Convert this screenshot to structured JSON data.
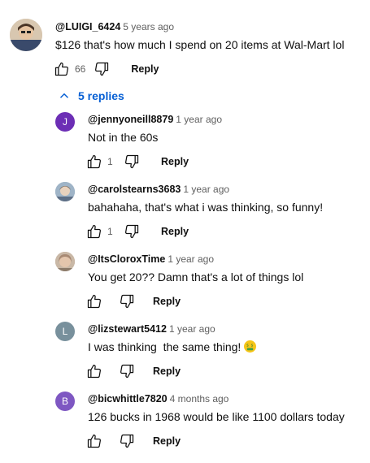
{
  "top_comment": {
    "author": "@LUIGI_6424",
    "time": "5 years ago",
    "text": "$126 that's how much I spend on 20 items at Wal-Mart lol",
    "likes": "66",
    "reply_label": "Reply"
  },
  "replies_toggle": {
    "label": "5 replies"
  },
  "replies": [
    {
      "author": "@jennyoneill8879",
      "time": "1 year ago",
      "text": "Not in the 60s",
      "likes": "1",
      "reply_label": "Reply",
      "avatar_letter": "J",
      "avatar_color": "#6c2eb5"
    },
    {
      "author": "@carolstearns3683",
      "time": "1 year ago",
      "text": "bahahaha, that's what i was thinking, so funny!",
      "likes": "1",
      "reply_label": "Reply",
      "avatar_letter": "",
      "avatar_color": "#8aa1b8"
    },
    {
      "author": "@ItsCloroxTime",
      "time": "1 year ago",
      "text": "You get 20?? Damn that's a lot of things lol",
      "likes": "",
      "reply_label": "Reply",
      "avatar_letter": "",
      "avatar_color": "#b59a86"
    },
    {
      "author": "@lizstewart5412",
      "time": "1 year ago",
      "text": "I was thinking  the same thing!",
      "likes": "",
      "reply_label": "Reply",
      "avatar_letter": "L",
      "avatar_color": "#78909c"
    },
    {
      "author": "@bicwhittle7820",
      "time": "4 months ago",
      "text": "126 bucks in 1968 would be like 1100 dollars today",
      "likes": "",
      "reply_label": "Reply",
      "avatar_letter": "B",
      "avatar_color": "#7e57c2"
    }
  ]
}
